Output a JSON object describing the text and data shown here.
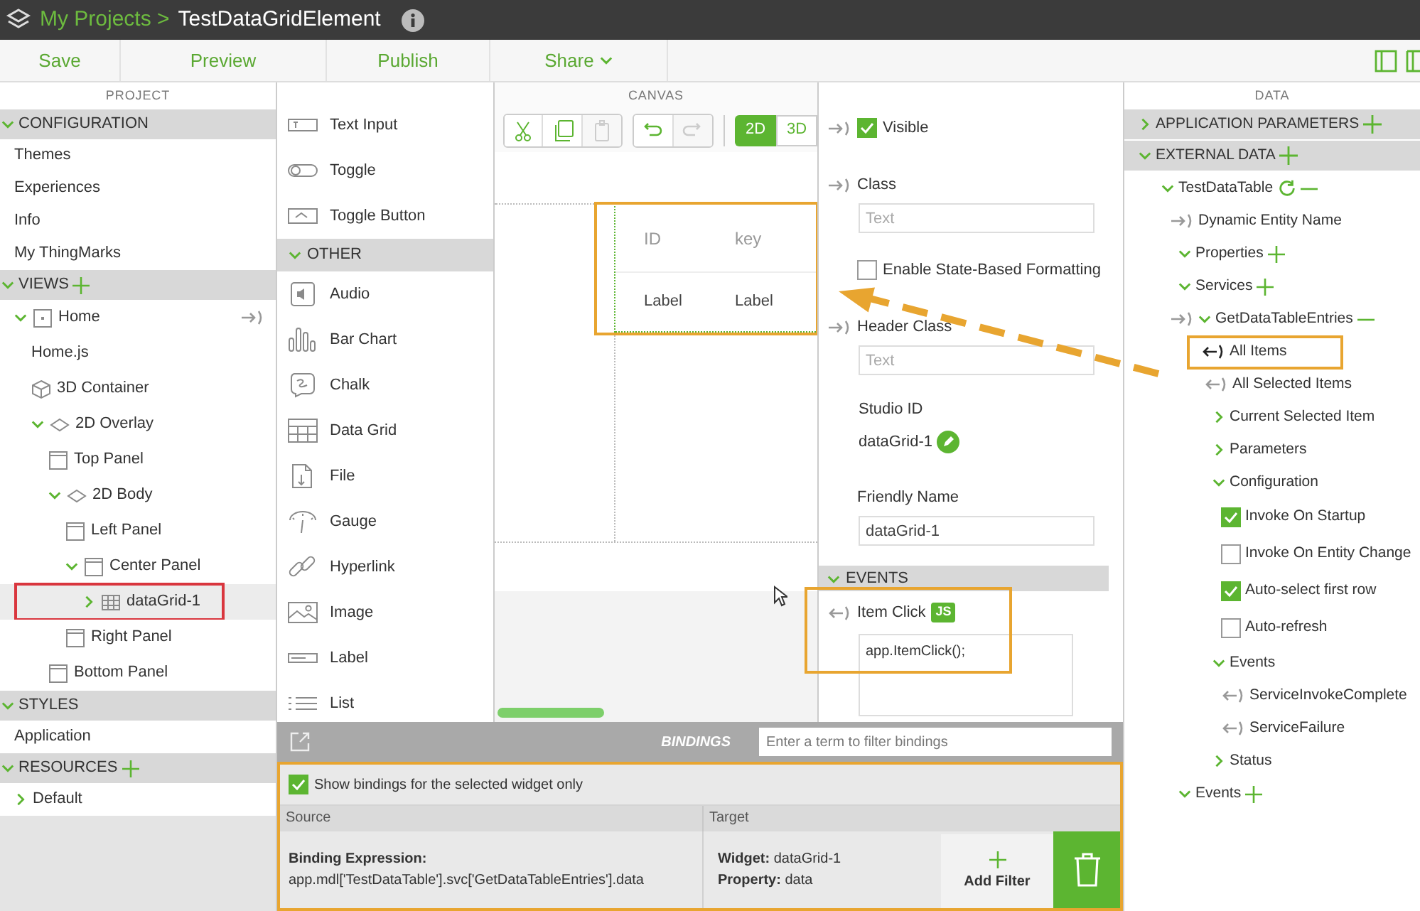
{
  "topbar": {
    "breadcrumb": "My Projects >",
    "title": "TestDataGridElement"
  },
  "toolbar": {
    "buttons": [
      {
        "label": "Save",
        "kind": "plain"
      },
      {
        "label": "Preview",
        "kind": "plain"
      },
      {
        "label": "Publish",
        "kind": "plain"
      },
      {
        "label": "Share",
        "kind": "menu"
      }
    ]
  },
  "project": {
    "header": "PROJECT",
    "sections": [
      {
        "title": "CONFIGURATION",
        "expanded": true,
        "items": [
          {
            "label": "Themes",
            "selected": false
          },
          {
            "label": "Experiences",
            "selected": false
          },
          {
            "label": "Info",
            "selected": false
          },
          {
            "label": "My ThingMarks",
            "selected": false
          }
        ]
      },
      {
        "title": "VIEWS",
        "expanded": true,
        "add": true,
        "items": [
          {
            "label": "Home",
            "kind": "page",
            "expanded": true,
            "bindable": true,
            "selected": false,
            "children": [
              {
                "label": "Home.js",
                "kind": "script",
                "selected": false
              },
              {
                "label": "3D Container",
                "kind": "cube",
                "selected": false
              },
              {
                "label": "2D Overlay",
                "kind": "layer",
                "expanded": true,
                "selected": false,
                "children": [
                  {
                    "label": "Top Panel",
                    "kind": "panel",
                    "selected": false
                  },
                  {
                    "label": "2D Body",
                    "kind": "layer",
                    "expanded": true,
                    "selected": false,
                    "children": [
                      {
                        "label": "Left Panel",
                        "kind": "panel",
                        "selected": false
                      },
                      {
                        "label": "Center Panel",
                        "kind": "panel",
                        "expanded": true,
                        "selected": false,
                        "children": [
                          {
                            "label": "dataGrid-1",
                            "kind": "grid",
                            "expanded": false,
                            "selected": true,
                            "highlighted": true
                          }
                        ]
                      },
                      {
                        "label": "Right Panel",
                        "kind": "panel",
                        "selected": false
                      }
                    ]
                  },
                  {
                    "label": "Bottom Panel",
                    "kind": "panel",
                    "selected": false
                  }
                ]
              }
            ]
          }
        ]
      },
      {
        "title": "STYLES",
        "expanded": true,
        "items": [
          {
            "label": "Application",
            "selected": false
          }
        ]
      },
      {
        "title": "RESOURCES",
        "expanded": true,
        "add": true,
        "items": [
          {
            "label": "Default",
            "expanded": false,
            "selected": false
          }
        ]
      }
    ]
  },
  "widgets": {
    "groups": [
      {
        "items": [
          {
            "kind": "text-input",
            "label": "Text Input"
          },
          {
            "kind": "toggle",
            "label": "Toggle"
          },
          {
            "kind": "toggle-button",
            "label": "Toggle Button"
          }
        ]
      },
      {
        "title": "OTHER",
        "expanded": true,
        "items": [
          {
            "kind": "audio",
            "label": "Audio"
          },
          {
            "kind": "bar-chart",
            "label": "Bar Chart"
          },
          {
            "kind": "chalk",
            "label": "Chalk"
          },
          {
            "kind": "data-grid",
            "label": "Data Grid"
          },
          {
            "kind": "file",
            "label": "File"
          },
          {
            "kind": "gauge",
            "label": "Gauge"
          },
          {
            "kind": "hyperlink",
            "label": "Hyperlink"
          },
          {
            "kind": "image",
            "label": "Image"
          },
          {
            "kind": "label",
            "label": "Label"
          },
          {
            "kind": "list",
            "label": "List"
          }
        ]
      }
    ]
  },
  "canvas": {
    "header": "CANVAS",
    "tools": [
      {
        "kind": "cut",
        "disabled": false
      },
      {
        "kind": "copy",
        "disabled": false
      },
      {
        "kind": "paste",
        "disabled": true
      },
      {
        "kind": "undo",
        "disabled": false
      },
      {
        "kind": "redo",
        "disabled": true
      }
    ],
    "modes": [
      {
        "label": "2D",
        "selected": true
      },
      {
        "label": "3D",
        "selected": false
      }
    ],
    "grid": {
      "columns": [
        "ID",
        "key"
      ],
      "row": [
        "Label",
        "Label"
      ],
      "highlighted": true
    }
  },
  "properties": {
    "fields": [
      {
        "kind": "checkbox",
        "label": "Visible",
        "checked": true,
        "bindable": true
      },
      {
        "kind": "input",
        "label": "Class",
        "placeholder": "Text",
        "bindable": true
      },
      {
        "kind": "checkbox",
        "label": "Enable State-Based Formatting",
        "checked": false
      },
      {
        "kind": "input",
        "label": "Header Class",
        "placeholder": "Text",
        "bindable": true
      },
      {
        "kind": "static",
        "label": "Studio ID",
        "value": "dataGrid-1"
      },
      {
        "kind": "input",
        "label": "Friendly Name",
        "value": "dataGrid-1"
      }
    ],
    "events_section": {
      "title": "EVENTS",
      "expanded": true
    },
    "events": [
      {
        "label": "Item Click",
        "badge": "JS",
        "code": "app.ItemClick();",
        "highlighted": true
      }
    ]
  },
  "data": {
    "header": "DATA",
    "sections": [
      {
        "title": "APPLICATION PARAMETERS",
        "expanded": false,
        "add": true
      },
      {
        "title": "EXTERNAL DATA",
        "expanded": true,
        "add": true,
        "items": [
          {
            "kind": "group",
            "label": "TestDataTable",
            "expanded": true,
            "refresh": true,
            "remove": true,
            "children": [
              {
                "kind": "binding-in",
                "label": "Dynamic Entity Name"
              },
              {
                "kind": "group",
                "label": "Properties",
                "expanded": true,
                "add": true
              },
              {
                "kind": "group",
                "label": "Services",
                "expanded": true,
                "add": true,
                "children": [
                  {
                    "kind": "group",
                    "label": "GetDataTableEntries",
                    "bindable": true,
                    "expanded": true,
                    "remove": true,
                    "children": [
                      {
                        "kind": "binding-out",
                        "label": "All Items",
                        "highlighted": true
                      },
                      {
                        "kind": "binding-out",
                        "label": "All Selected Items"
                      },
                      {
                        "kind": "group",
                        "label": "Current Selected Item",
                        "expanded": false
                      },
                      {
                        "kind": "group",
                        "label": "Parameters",
                        "expanded": false
                      },
                      {
                        "kind": "group",
                        "label": "Configuration",
                        "expanded": true,
                        "children": [
                          {
                            "kind": "checkbox",
                            "label": "Invoke On Startup",
                            "checked": true
                          },
                          {
                            "kind": "checkbox",
                            "label": "Invoke On Entity Change",
                            "checked": false
                          },
                          {
                            "kind": "checkbox",
                            "label": "Auto-select first row",
                            "checked": true
                          },
                          {
                            "kind": "checkbox",
                            "label": "Auto-refresh",
                            "checked": false
                          }
                        ]
                      },
                      {
                        "kind": "group",
                        "label": "Events",
                        "expanded": true,
                        "children": [
                          {
                            "kind": "binding-out",
                            "label": "ServiceInvokeComplete"
                          },
                          {
                            "kind": "binding-out",
                            "label": "ServiceFailure"
                          }
                        ]
                      },
                      {
                        "kind": "group",
                        "label": "Status",
                        "expanded": false
                      }
                    ]
                  }
                ]
              },
              {
                "kind": "group",
                "label": "Events",
                "expanded": true,
                "add": true
              }
            ]
          }
        ]
      }
    ]
  },
  "bindings": {
    "title": "BINDINGS",
    "filter_placeholder": "Enter a term to filter bindings",
    "selected_only": {
      "label": "Show bindings for the selected widget only",
      "checked": true
    },
    "columns": [
      "Source",
      "Target"
    ],
    "rows": [
      {
        "source_label": "Binding Expression:",
        "source": "app.mdl['TestDataTable'].svc['GetDataTableEntries'].data",
        "target": [
          "**Widget:** dataGrid-1",
          "**Property:** data"
        ]
      }
    ],
    "add_filter": "Add Filter"
  }
}
